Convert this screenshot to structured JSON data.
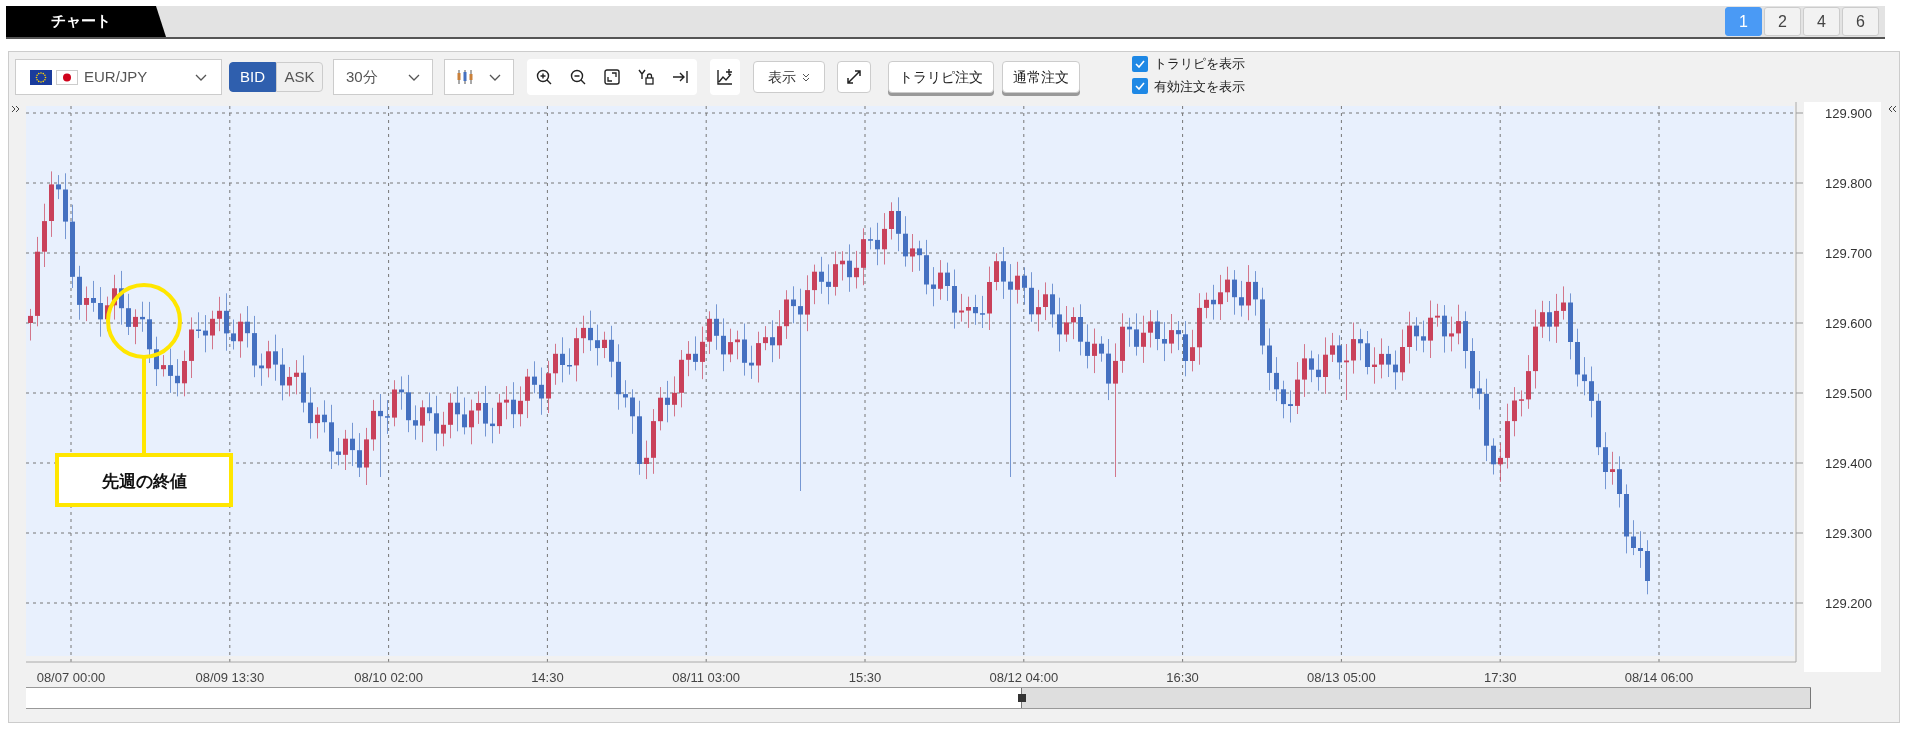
{
  "tab_bar": {
    "title": "チャート",
    "layouts": [
      {
        "label": "1",
        "selected": true
      },
      {
        "label": "2",
        "selected": false
      },
      {
        "label": "4",
        "selected": false
      },
      {
        "label": "6",
        "selected": false
      }
    ]
  },
  "toolbar": {
    "symbol": "EUR/JPY",
    "price_types": [
      {
        "label": "BID",
        "selected": true
      },
      {
        "label": "ASK",
        "selected": false
      }
    ],
    "interval": "30分",
    "display": "表示",
    "order_buttons": [
      "トラリピ注文",
      "通常注文"
    ],
    "checkboxes": [
      {
        "label": "トラリピを表示",
        "checked": true
      },
      {
        "label": "有効注文を表示",
        "checked": true
      }
    ]
  },
  "chart": {
    "y_ticks": [
      "129.900",
      "129.800",
      "129.700",
      "129.600",
      "129.500",
      "129.400",
      "129.300",
      "129.200"
    ],
    "x_ticks": [
      "08/07 00:00",
      "08/09 13:30",
      "08/10 02:00",
      "14:30",
      "08/11 03:00",
      "15:30",
      "08/12 04:00",
      "16:30",
      "08/13 05:00",
      "17:30",
      "08/14 06:00"
    ],
    "callout": "先週の終値"
  }
}
